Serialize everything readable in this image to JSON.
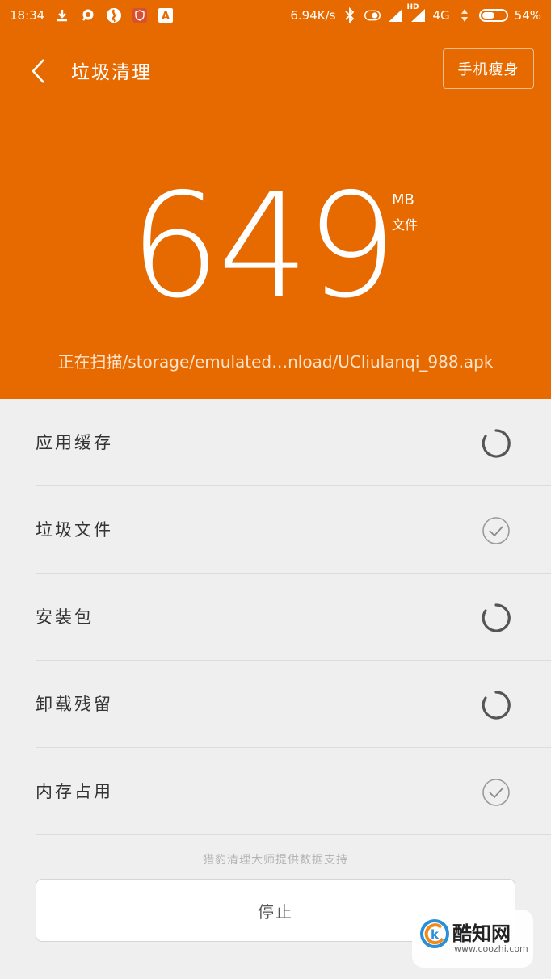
{
  "status_bar": {
    "time": "18:34",
    "speed": "6.94K/s",
    "hd": "HD",
    "network": "4G",
    "battery_text": "54%",
    "battery_level": 0.54,
    "left_icons": [
      "download-icon",
      "chat-icon",
      "browser-icon",
      "shield-icon",
      "app-a-icon"
    ],
    "app_a_glyph": "A"
  },
  "header": {
    "title": "垃圾清理",
    "slim_button": "手机瘦身",
    "size_value": "649",
    "size_unit": "MB",
    "size_label": "文件",
    "scan_text": "正在扫描/storage/emulated…nload/UCliulanqi_988.apk",
    "accent_color": "#e76a00"
  },
  "items": [
    {
      "label": "应用缓存",
      "status": "loading"
    },
    {
      "label": "垃圾文件",
      "status": "done"
    },
    {
      "label": "安装包",
      "status": "loading"
    },
    {
      "label": "卸载残留",
      "status": "loading"
    },
    {
      "label": "内存占用",
      "status": "done"
    }
  ],
  "credit": "猎豹清理大师提供数据支持",
  "stop_button": "停止",
  "watermark": {
    "name": "酷知网",
    "url": "www.coozhi.com"
  }
}
